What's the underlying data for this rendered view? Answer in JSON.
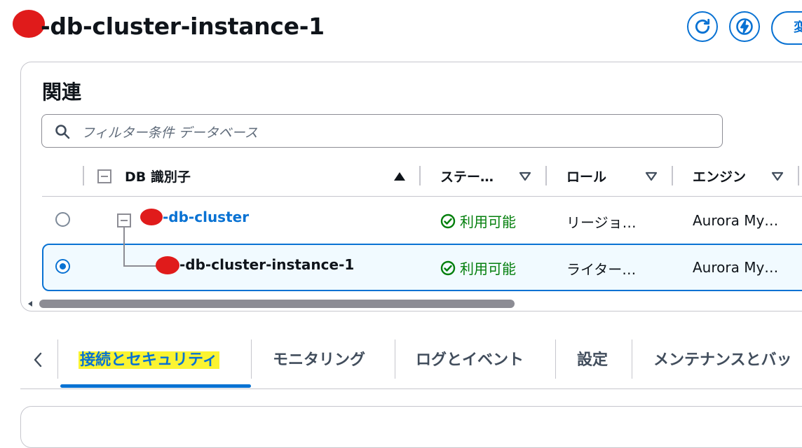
{
  "header": {
    "title": "-db-cluster-instance-1",
    "edit_label": "変"
  },
  "related": {
    "title": "関連",
    "filter_placeholder": "フィルター条件 データベース",
    "columns": [
      "DB 識別子",
      "ステー…",
      "ロール",
      "エンジン"
    ],
    "rows": [
      {
        "identifier": "-db-cluster",
        "status": "利用可能",
        "role": "リージョ…",
        "engine": "Aurora My…",
        "selected": false
      },
      {
        "identifier": "-db-cluster-instance-1",
        "status": "利用可能",
        "role": "ライター…",
        "engine": "Aurora My…",
        "selected": true
      }
    ],
    "scroll_fraction": 0.61
  },
  "tabs": {
    "items": [
      "接続とセキュリティ",
      "モニタリング",
      "ログとイベント",
      "設定",
      "メンテナンスとバッ"
    ],
    "active_index": 0
  },
  "colors": {
    "accent": "#0972d3",
    "success": "#037f0c",
    "highlight": "#fbf431",
    "redaction": "#e01b1b"
  }
}
